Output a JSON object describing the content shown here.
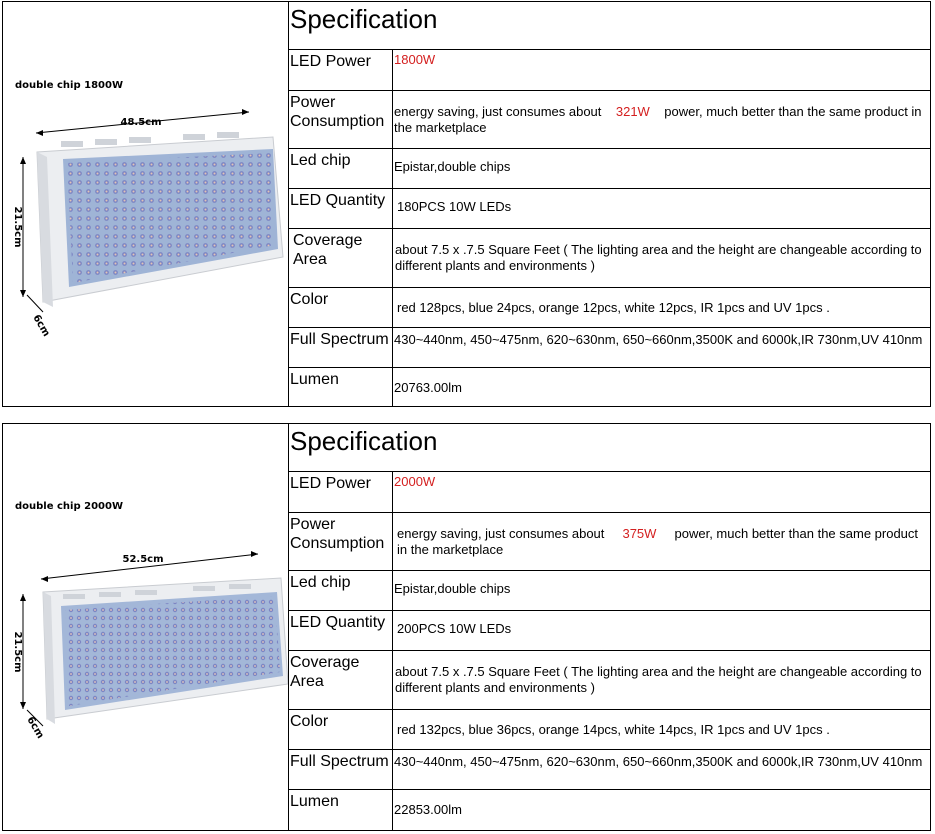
{
  "products": [
    {
      "image_label": "double chip 1800W",
      "dim_width": "48.5cm",
      "dim_height": "21.5cm",
      "dim_depth": "6cm",
      "spec_title": "Specification",
      "rows": {
        "led_power": {
          "label": "LED Power",
          "value": "1800W"
        },
        "power_consumption": {
          "label": "Power Consumption",
          "pre": "energy saving,  just consumes about",
          "watts": "321W",
          "post": "power, much better than the same product in the marketplace"
        },
        "led_chip": {
          "label": "Led chip",
          "value": "Epistar,double chips"
        },
        "led_quantity": {
          "label": "LED Quantity",
          "value": "180PCS 10W LEDs"
        },
        "coverage": {
          "label": "Coverage Area",
          "value": "about 7.5 x .7.5 Square Feet ( The lighting area and the height are changeable according to different plants and environments )"
        },
        "color": {
          "label": "Color",
          "value": "red 128pcs, blue 24pcs, orange 12pcs, white 12pcs,  IR 1pcs and UV 1pcs ."
        },
        "full_spectrum": {
          "label": "Full Spectrum",
          "value": "430~440nm, 450~475nm, 620~630nm, 650~660nm,3500K and 6000k,IR 730nm,UV 410nm"
        },
        "lumen": {
          "label": "Lumen",
          "value": "20763.00lm"
        }
      }
    },
    {
      "image_label": "double chip 2000W",
      "dim_width": "52.5cm",
      "dim_height": "21.5cm",
      "dim_depth": "6cm",
      "spec_title": "Specification",
      "rows": {
        "led_power": {
          "label": "LED Power",
          "value": "2000W"
        },
        "power_consumption": {
          "label": "Power Consumption",
          "pre": "energy saving,  just consumes about",
          "watts": "375W",
          "post": "power, much better than the same product in the marketplace"
        },
        "led_chip": {
          "label": "Led chip",
          "value": "Epistar,double chips"
        },
        "led_quantity": {
          "label": "LED Quantity",
          "value": "200PCS 10W LEDs"
        },
        "coverage": {
          "label": "Coverage Area",
          "value": "about 7.5 x .7.5 Square Feet ( The lighting area and the height are changeable according to different plants and environments )"
        },
        "color": {
          "label": "Color",
          "value": "red 132pcs, blue 36pcs, orange 14pcs, white 14pcs,  IR 1pcs and UV 1pcs ."
        },
        "full_spectrum": {
          "label": "Full Spectrum",
          "value": "430~440nm, 450~475nm, 620~630nm, 650~660nm,3500K and 6000k,IR 730nm,UV 410nm"
        },
        "lumen": {
          "label": "Lumen",
          "value": "22853.00lm"
        }
      }
    }
  ]
}
